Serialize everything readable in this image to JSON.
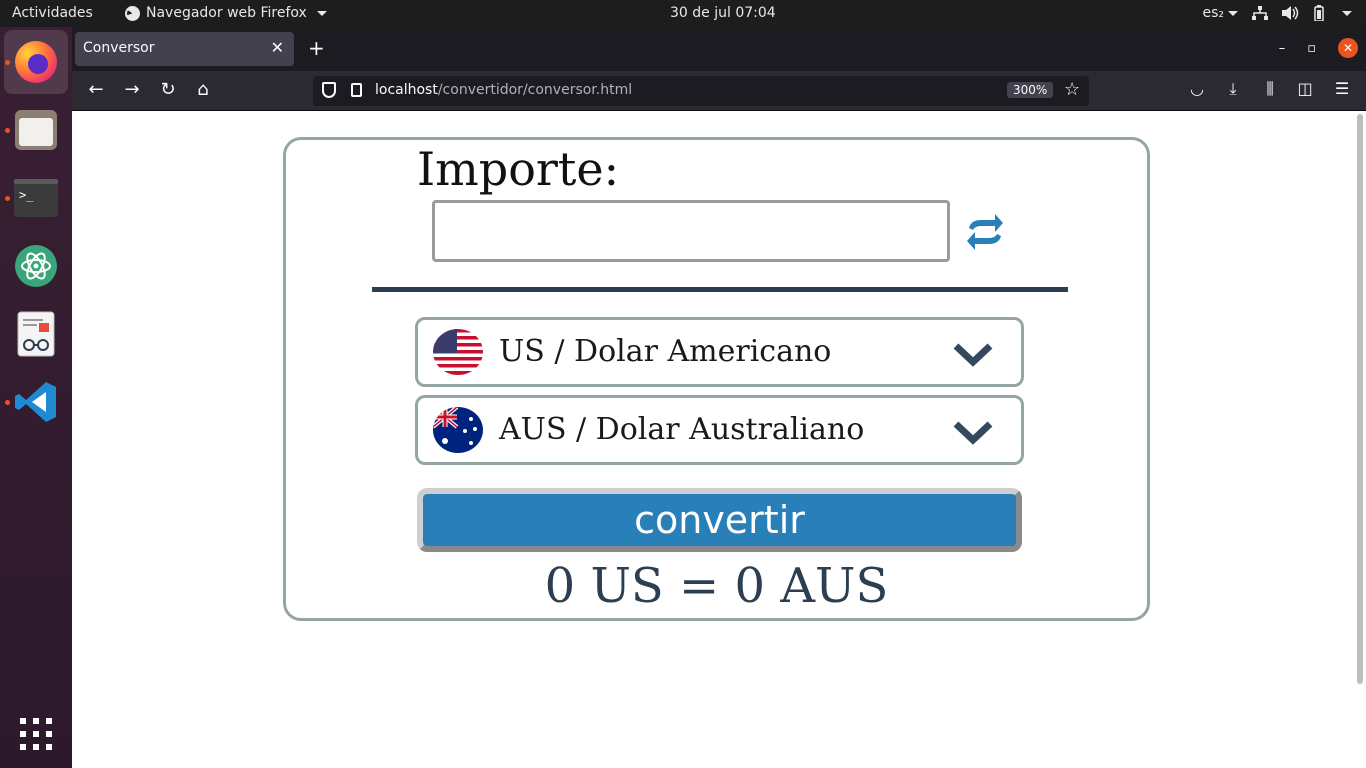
{
  "topbar": {
    "activities": "Actividades",
    "app_menu": "Navegador web Firefox",
    "clock": "30 de jul  07:04",
    "keyboard_layout": "es₂"
  },
  "dock": {
    "items": [
      {
        "icon": "firefox-icon",
        "running": true,
        "active": true
      },
      {
        "icon": "files-icon",
        "running": true
      },
      {
        "icon": "terminal-icon",
        "running": true
      },
      {
        "icon": "atom-icon",
        "running": false
      },
      {
        "icon": "document-viewer-icon",
        "running": false
      },
      {
        "icon": "vscode-icon",
        "running": true
      },
      {
        "icon": "show-apps-icon",
        "running": false
      }
    ]
  },
  "browser": {
    "tab_title": "Conversor",
    "url_host": "localhost",
    "url_path": "/convertidor/conversor.html",
    "zoom": "300%"
  },
  "converter": {
    "amount_label": "Importe:",
    "amount_value": "",
    "from_currency": "US / Dolar Americano",
    "to_currency": "AUS / Dolar Australiano",
    "convert_label": "convertir",
    "result": "0 US = 0 AUS"
  },
  "colors": {
    "accent": "#2980b9",
    "text_dark": "#2c3e50",
    "border": "#95a5a6",
    "ubuntu_orange": "#e95420"
  }
}
